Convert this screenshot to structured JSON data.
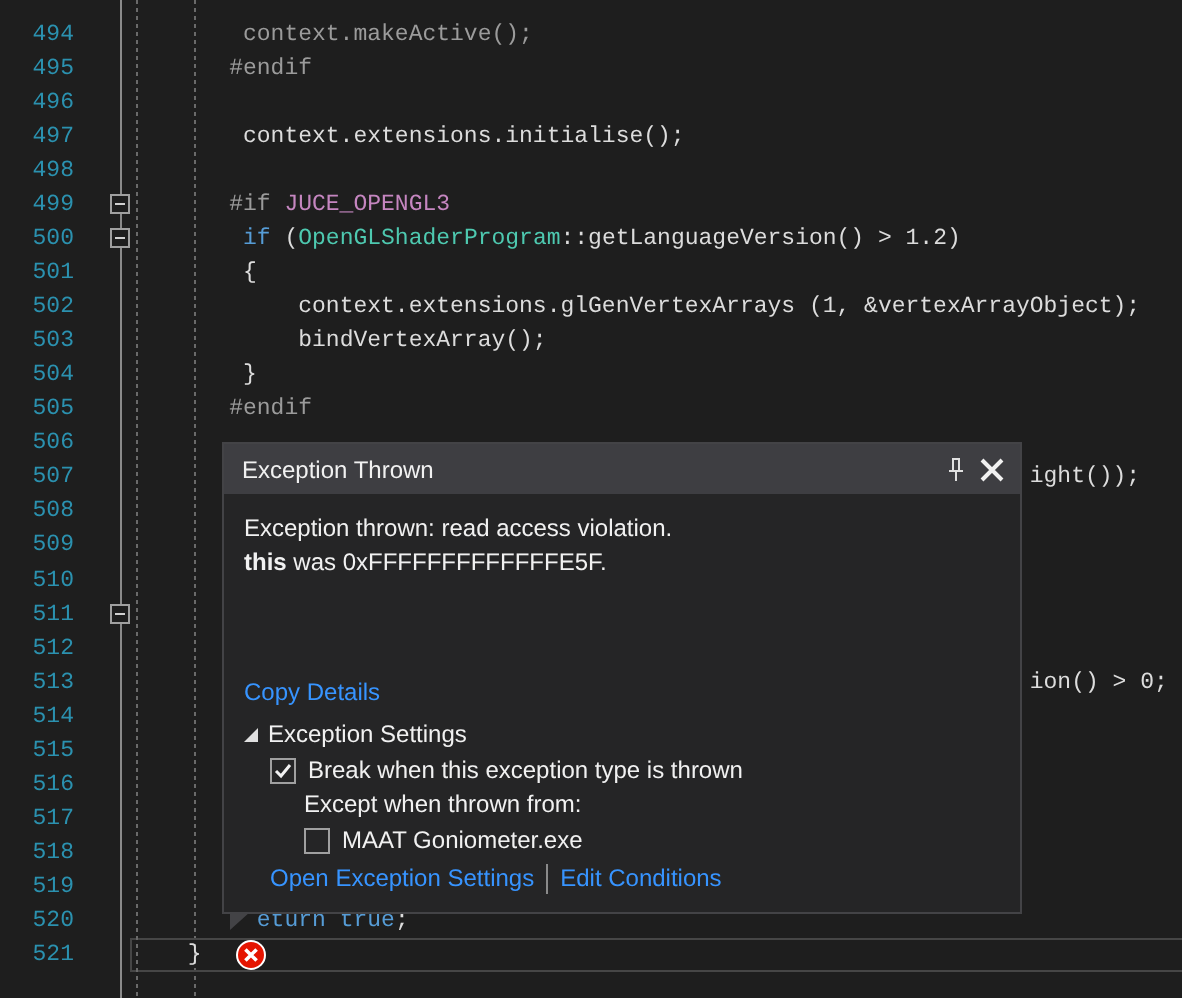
{
  "editor": {
    "lines": [
      {
        "number": "494",
        "fold": false,
        "current": false,
        "error": false,
        "tokens": [
          {
            "text": "     context.makeActive();",
            "kind": "inactive"
          }
        ]
      },
      {
        "number": "495",
        "fold": false,
        "current": false,
        "error": false,
        "tokens": [
          {
            "text": "    #endif",
            "kind": "preprocessor"
          }
        ]
      },
      {
        "number": "496",
        "fold": false,
        "current": false,
        "error": false
      },
      {
        "number": "497",
        "fold": false,
        "current": false,
        "error": false,
        "tokens": [
          {
            "text": "     context.extensions.initialise();",
            "kind": "plain"
          }
        ]
      },
      {
        "number": "498",
        "fold": false,
        "current": false,
        "error": false
      },
      {
        "number": "499",
        "fold": true,
        "current": false,
        "error": false,
        "tokens": [
          {
            "text": "    #if ",
            "kind": "preprocessor"
          },
          {
            "text": "JUCE_OPENGL3",
            "kind": "macro"
          }
        ]
      },
      {
        "number": "500",
        "fold": true,
        "current": false,
        "error": false,
        "tokens": [
          {
            "text": "     if",
            "kind": "keyword"
          },
          {
            "text": " (",
            "kind": "plain"
          },
          {
            "text": "OpenGLShaderProgram",
            "kind": "type"
          },
          {
            "text": "::getLanguageVersion() > 1.2)",
            "kind": "plain"
          }
        ]
      },
      {
        "number": "501",
        "fold": false,
        "current": false,
        "error": false,
        "tokens": [
          {
            "text": "     {",
            "kind": "plain"
          }
        ]
      },
      {
        "number": "502",
        "fold": false,
        "current": false,
        "error": false,
        "tokens": [
          {
            "text": "         context.extensions.glGenVertexArrays (1, &vertexArrayObject);",
            "kind": "plain"
          }
        ]
      },
      {
        "number": "503",
        "fold": false,
        "current": false,
        "error": false,
        "tokens": [
          {
            "text": "         bindVertexArray();",
            "kind": "plain"
          }
        ]
      },
      {
        "number": "504",
        "fold": false,
        "current": false,
        "error": false,
        "tokens": [
          {
            "text": "     }",
            "kind": "plain"
          }
        ]
      },
      {
        "number": "505",
        "fold": false,
        "current": false,
        "error": false,
        "tokens": [
          {
            "text": "    #endif",
            "kind": "preprocessor"
          }
        ]
      },
      {
        "number": "506",
        "fold": false,
        "current": false,
        "error": false
      },
      {
        "number": "507",
        "fold": false,
        "current": false,
        "error": false,
        "tokens": [
          {
            "text": "                                                              ight());",
            "kind": "plain"
          }
        ]
      },
      {
        "number": "508",
        "fold": false,
        "current": false,
        "error": false
      },
      {
        "number": "509",
        "fold": false,
        "current": false,
        "error": false
      },
      {
        "number": "510",
        "fold": false,
        "current": false,
        "error": false
      },
      {
        "number": "511",
        "fold": true,
        "current": false,
        "error": false
      },
      {
        "number": "512",
        "fold": false,
        "current": false,
        "error": false
      },
      {
        "number": "513",
        "fold": false,
        "current": false,
        "error": false,
        "tokens": [
          {
            "text": "                                                              ion() > 0;",
            "kind": "plain"
          }
        ]
      },
      {
        "number": "514",
        "fold": false,
        "current": false,
        "error": false
      },
      {
        "number": "515",
        "fold": false,
        "current": false,
        "error": false
      },
      {
        "number": "516",
        "fold": false,
        "current": false,
        "error": false
      },
      {
        "number": "517",
        "fold": false,
        "current": false,
        "error": false
      },
      {
        "number": "518",
        "fold": false,
        "current": false,
        "error": false
      },
      {
        "number": "519",
        "fold": false,
        "current": false,
        "error": false
      },
      {
        "number": "520",
        "fold": false,
        "current": false,
        "error": false,
        "tokens": [
          {
            "text": "      eturn",
            "kind": "keyword"
          },
          {
            "text": " true",
            "kind": "keyword"
          },
          {
            "text": ";",
            "kind": "plain"
          }
        ]
      },
      {
        "number": "521",
        "fold": false,
        "current": true,
        "error": true,
        "tokens": [
          {
            "text": " }",
            "kind": "plain"
          }
        ]
      }
    ]
  },
  "exception_dialog": {
    "title": "Exception Thrown",
    "message": "Exception thrown: read access violation.",
    "detail": "**this** was 0xFFFFFFFFFFFFFE5F.",
    "copy_link": "Copy Details",
    "settings": {
      "label": "Exception Settings",
      "expanded": true,
      "break_option": {
        "label": "Break when this exception type is thrown",
        "checked": true
      },
      "except_label": "Except when thrown from:",
      "modules": [
        {
          "label": "MAAT Goniometer.exe",
          "checked": false
        }
      ]
    },
    "links": [
      "Open Exception Settings",
      "Edit Conditions"
    ]
  }
}
